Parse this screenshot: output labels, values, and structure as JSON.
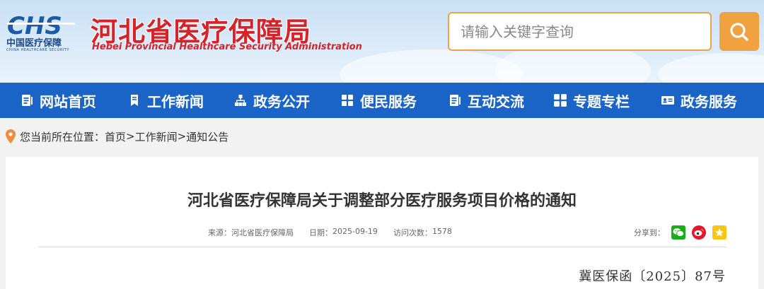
{
  "header": {
    "logo_abbr": "CHS",
    "logo_org_cn": "中国医疗保障",
    "logo_org_en": "CHINA HEALTHCARE SECURITY",
    "site_title": "河北省医疗保障局",
    "site_subtitle": "Hebei Provincial Healthcare Security Administration",
    "search_placeholder": "请输入关键字查询",
    "search_icon": "search-icon"
  },
  "nav": {
    "items": [
      {
        "label": "网站首页",
        "icon": "document-icon"
      },
      {
        "label": "工作新闻",
        "icon": "bookmark-icon"
      },
      {
        "label": "政务公开",
        "icon": "sitemap-icon"
      },
      {
        "label": "便民服务",
        "icon": "grid-icon"
      },
      {
        "label": "互动交流",
        "icon": "document-icon"
      },
      {
        "label": "专题专栏",
        "icon": "grid-icon"
      },
      {
        "label": "政务服务",
        "icon": "id-card-icon"
      }
    ]
  },
  "breadcrumb": {
    "prefix": "您当前所在位置：",
    "items": [
      "首页",
      "工作新闻",
      "通知公告"
    ],
    "separator": ">"
  },
  "article": {
    "title": "河北省医疗保障局关于调整部分医疗服务项目价格的通知",
    "source_label": "来源：",
    "source_value": "河北省医疗保障局",
    "date_label": "日期：",
    "date_value": "2025-09-19",
    "views_label": "访问次数：",
    "views_value": "1578",
    "share_label": "分享到：",
    "share_targets": [
      "wechat-icon",
      "weibo-icon",
      "qzone-icon"
    ],
    "doc_number": "冀医保函〔2025〕87号"
  },
  "colors": {
    "nav_bg": "#1a64c7",
    "accent_orange": "#f0a240",
    "title_red": "#d8222a",
    "wechat": "#1aad19",
    "weibo": "#e6162d",
    "qzone": "#f5c518"
  }
}
